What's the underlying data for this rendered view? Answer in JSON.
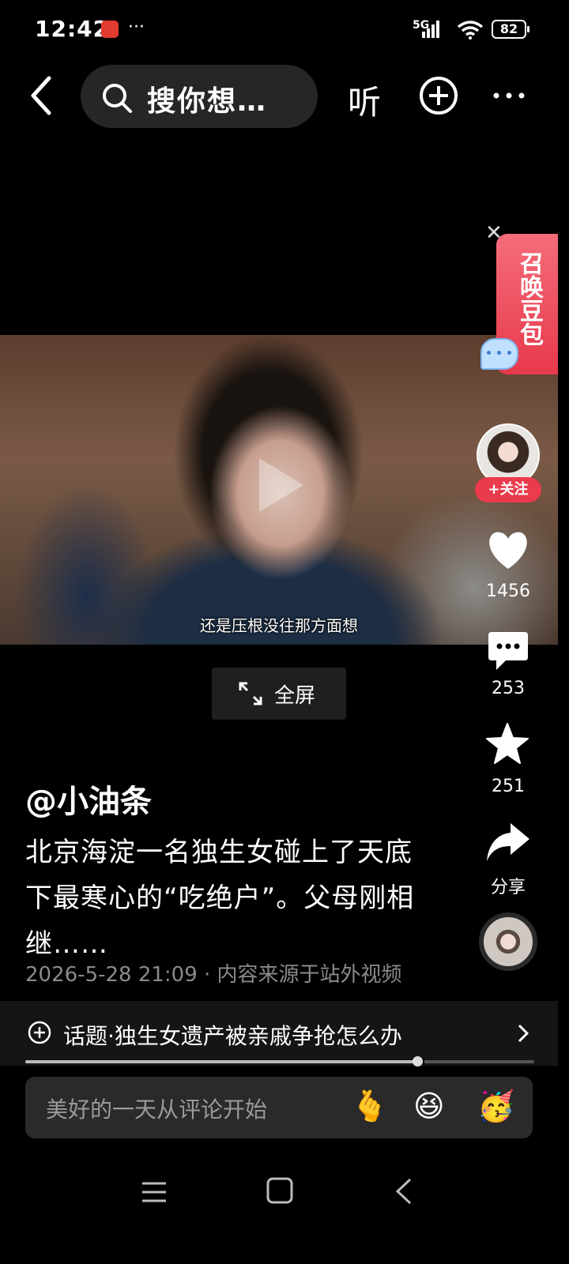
{
  "status_bar": {
    "time": "12:42",
    "more": "···",
    "network": "5G",
    "battery": "82"
  },
  "top_bar": {
    "search_placeholder": "搜你想…",
    "listen_label": "听"
  },
  "video": {
    "subtitle": "还是压根没往那方面想",
    "fullscreen_label": "全屏"
  },
  "doubao": {
    "label": "召唤豆包"
  },
  "rail": {
    "follow_label": "+关注",
    "likes": "1456",
    "comments": "253",
    "favorites": "251",
    "share_label": "分享"
  },
  "post": {
    "author": "@小油条",
    "description": "北京海淀一名独生女碰上了天底下最寒心的“吃绝户”。父母刚相继……",
    "meta": "2026-5-28 21:09 · 内容来源于站外视频",
    "topic": "话题·独生女遗产被亲戚争抢怎么办",
    "progress": 0.77
  },
  "comment": {
    "placeholder": "美好的一天从评论开始",
    "emojis": [
      "🫰",
      "😆",
      "🥳"
    ]
  },
  "colors": {
    "accent": "#ea3b4c",
    "background": "#000000"
  }
}
